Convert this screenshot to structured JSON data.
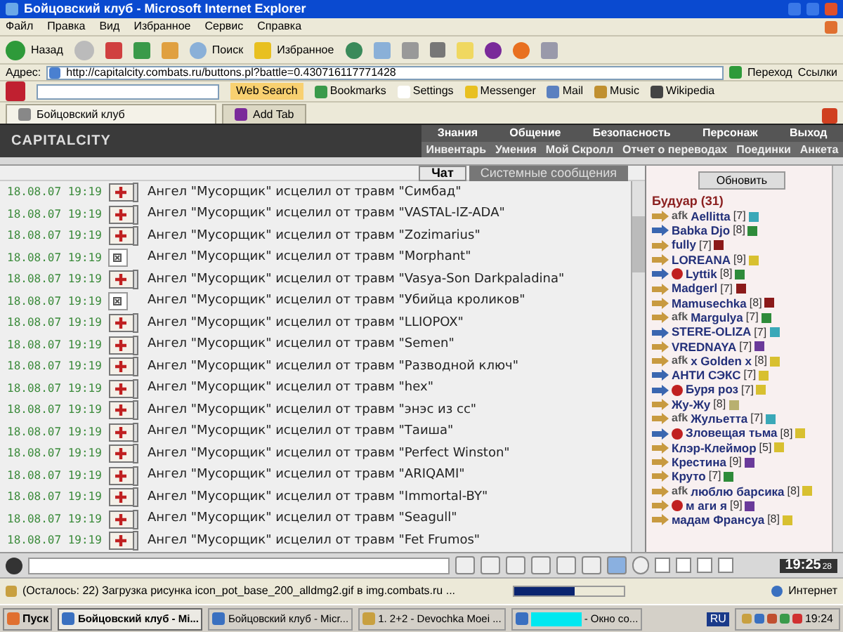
{
  "window": {
    "title": "Бойцовский клуб - Microsoft Internet Explorer"
  },
  "menu": [
    "Файл",
    "Правка",
    "Вид",
    "Избранное",
    "Сервис",
    "Справка"
  ],
  "toolbar": {
    "back": "Назад",
    "search": "Поиск",
    "favorites": "Избранное"
  },
  "address": {
    "label": "Адрес:",
    "value": "http://capitalcity.combats.ru/buttons.pl?battle=0.430716117771428",
    "go": "Переход",
    "links": "Ссылки"
  },
  "yahoo": {
    "search_button": "Web Search",
    "items": [
      "Bookmarks",
      "Settings",
      "Messenger",
      "Mail",
      "Music",
      "Wikipedia"
    ]
  },
  "tabs": [
    {
      "label": "Бойцовский клуб",
      "selected": true
    },
    {
      "label": "Add Tab",
      "selected": false
    }
  ],
  "game": {
    "logo": "CAPITALCITY",
    "nav_top": [
      "Знания",
      "Общение",
      "Безопасность",
      "Персонаж",
      "Выход"
    ],
    "nav_bottom": [
      "Инвентарь",
      "Умения",
      "Мой Скролл",
      "Отчет о переводах",
      "Поединки",
      "Анкета"
    ]
  },
  "chat_tabs": [
    {
      "label": "Чат",
      "selected": true
    },
    {
      "label": "Системные сообщения",
      "selected": false
    }
  ],
  "chat": [
    {
      "time": "18.08.07 19:19",
      "kind": "scroll",
      "text": "Ангел \"Мусорщик\" исцелил от травм \"Симбад\""
    },
    {
      "time": "18.08.07 19:19",
      "kind": "scroll",
      "text": "Ангел \"Мусорщик\" исцелил от травм \"VASTAL-IZ-ADA\""
    },
    {
      "time": "18.08.07 19:19",
      "kind": "scroll",
      "text": "Ангел \"Мусорщик\" исцелил от травм \"Zozimarius\""
    },
    {
      "time": "18.08.07 19:19",
      "kind": "broken",
      "text": "Ангел \"Мусорщик\" исцелил от травм \"Morphant\""
    },
    {
      "time": "18.08.07 19:19",
      "kind": "scroll",
      "text": "Ангел \"Мусорщик\" исцелил от травм \"Vasya-Son Darkpaladina\""
    },
    {
      "time": "18.08.07 19:19",
      "kind": "broken",
      "text": "Ангел \"Мусорщик\" исцелил от травм \"Убийца кроликов\""
    },
    {
      "time": "18.08.07 19:19",
      "kind": "scroll",
      "text": "Ангел \"Мусорщик\" исцелил от травм \"LLIOPOX\""
    },
    {
      "time": "18.08.07 19:19",
      "kind": "scroll",
      "text": "Ангел \"Мусорщик\" исцелил от травм \"Semen\""
    },
    {
      "time": "18.08.07 19:19",
      "kind": "scroll",
      "text": "Ангел \"Мусорщик\" исцелил от травм \"Разводной ключ\""
    },
    {
      "time": "18.08.07 19:19",
      "kind": "scroll",
      "text": "Ангел \"Мусорщик\" исцелил от травм \"hex\""
    },
    {
      "time": "18.08.07 19:19",
      "kind": "scroll",
      "text": "Ангел \"Мусорщик\" исцелил от травм \"энэс из сс\""
    },
    {
      "time": "18.08.07 19:19",
      "kind": "scroll",
      "text": "Ангел \"Мусорщик\" исцелил от травм \"Таиша\""
    },
    {
      "time": "18.08.07 19:19",
      "kind": "scroll",
      "text": "Ангел \"Мусорщик\" исцелил от травм \"Perfect Winston\""
    },
    {
      "time": "18.08.07 19:19",
      "kind": "scroll",
      "text": "Ангел \"Мусорщик\" исцелил от травм \"ARIQAMI\""
    },
    {
      "time": "18.08.07 19:19",
      "kind": "scroll",
      "text": "Ангел \"Мусорщик\" исцелил от травм \"Immortal-BY\""
    },
    {
      "time": "18.08.07 19:19",
      "kind": "scroll",
      "text": "Ангел \"Мусорщик\" исцелил от травм \"Seagull\""
    },
    {
      "time": "18.08.07 19:19",
      "kind": "scroll",
      "text": "Ангел \"Мусорщик\" исцелил от травм \"Fet Frumos\""
    }
  ],
  "users_panel": {
    "refresh": "Обновить",
    "room": "Будуар (31)"
  },
  "users": [
    {
      "prefix": "afk",
      "name": "Aellitta",
      "level": "[7]",
      "kind": "gold",
      "emblem": false,
      "color": "#3aa8b8"
    },
    {
      "name": "Babka Djo",
      "level": "[8]",
      "kind": "blue",
      "emblem": false,
      "color": "#2e8b3a"
    },
    {
      "name": "fully",
      "level": "[7]",
      "kind": "gold",
      "emblem": false,
      "color": "#8b1a1a"
    },
    {
      "name": "LOREANA",
      "level": "[9]",
      "kind": "gold",
      "emblem": false,
      "color": "#d8c030"
    },
    {
      "name": "Lyttik",
      "level": "[8]",
      "kind": "blue",
      "emblem": true,
      "color": "#2e8b3a"
    },
    {
      "name": "Madgerl",
      "level": "[7]",
      "kind": "gold",
      "emblem": false,
      "color": "#8b1a1a"
    },
    {
      "name": "Mamusechka",
      "level": "[8]",
      "kind": "gold",
      "emblem": false,
      "color": "#8b1a1a"
    },
    {
      "prefix": "afk",
      "name": "Margulya",
      "level": "[7]",
      "kind": "gold",
      "emblem": false,
      "color": "#2e8b3a"
    },
    {
      "name": "STERE-OLIZA",
      "level": "[7]",
      "kind": "blue",
      "emblem": false,
      "color": "#3aa8b8"
    },
    {
      "name": "VREDNAYA",
      "level": "[7]",
      "kind": "gold",
      "emblem": false,
      "color": "#6a3a9a"
    },
    {
      "prefix": "afk",
      "name": "x Golden x",
      "level": "[8]",
      "kind": "gold",
      "emblem": false,
      "color": "#d8c030"
    },
    {
      "name": "АНТИ СЭКС",
      "level": "[7]",
      "kind": "blue",
      "emblem": false,
      "color": "#d8c030"
    },
    {
      "name": "Буря роз",
      "level": "[7]",
      "kind": "blue",
      "emblem": true,
      "color": "#d8c030"
    },
    {
      "name": "Жу-Жу",
      "level": "[8]",
      "kind": "gold",
      "emblem": false,
      "color": "#b8b070"
    },
    {
      "prefix": "afk",
      "name": "Жульетта",
      "level": "[7]",
      "kind": "gold",
      "emblem": false,
      "color": "#3aa8b8"
    },
    {
      "name": "Зловещая тьма",
      "level": "[8]",
      "kind": "blue",
      "emblem": true,
      "color": "#d8c030"
    },
    {
      "name": "Клэр-Клеймор",
      "level": "[5]",
      "kind": "gold",
      "emblem": false,
      "color": "#d8c030"
    },
    {
      "name": "Крестина",
      "level": "[9]",
      "kind": "gold",
      "emblem": false,
      "color": "#6a3a9a"
    },
    {
      "name": "Круто",
      "level": "[7]",
      "kind": "gold",
      "emblem": false,
      "color": "#2e8b3a"
    },
    {
      "prefix": "afk",
      "name": "люблю барсика",
      "level": "[8]",
      "kind": "gold",
      "emblem": false,
      "color": "#d8c030"
    },
    {
      "name": "м аги я",
      "level": "[9]",
      "kind": "gold",
      "emblem": true,
      "color": "#6a3a9a"
    },
    {
      "name": "мадам Франсуа",
      "level": "[8]",
      "kind": "gold",
      "emblem": false,
      "color": "#d8c030"
    }
  ],
  "game_clock": {
    "time": "19:25",
    "seconds": "28"
  },
  "status_bar": {
    "text": "(Осталось: 22) Загрузка рисунка icon_pot_base_200_alldmg2.gif в img.combats.ru ...",
    "level": 0.55,
    "zone": "Интернет"
  },
  "taskbar": {
    "start": "Пуск",
    "items": [
      {
        "label": "Бойцовский клуб - Mi...",
        "selected": true
      },
      {
        "label": "Бойцовский клуб - Micr...",
        "selected": false
      },
      {
        "label": "1. 2+2 - Devochka Moei ...",
        "selected": false
      },
      {
        "label": "- Окно со...",
        "selected": false
      }
    ],
    "lang": "RU",
    "clock": "19:24"
  }
}
